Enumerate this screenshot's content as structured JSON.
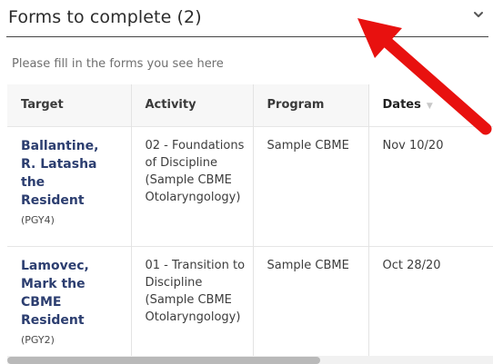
{
  "header": {
    "title": "Forms to complete (2)",
    "toggle_icon": "chevron-down-icon"
  },
  "subtitle": "Please fill in the forms you see here",
  "table": {
    "columns": [
      "Target",
      "Activity",
      "Program",
      "Dates"
    ],
    "sort_icon": "sort-down-icon",
    "rows": [
      {
        "target_name": "Ballantine, R. Latasha the Resident",
        "target_level": "(PGY4)",
        "activity": "02 - Foundations of Discipline (Sample CBME Otolaryngology)",
        "program": "Sample CBME",
        "date": "Nov 10/20"
      },
      {
        "target_name": "Lamovec, Mark the CBME Resident",
        "target_level": "(PGY2)",
        "activity": "01 - Transition to Discipline (Sample CBME Otolaryngology)",
        "program": "Sample CBME",
        "date": "Oct 28/20"
      }
    ]
  },
  "annotation": {
    "type": "red-arrow",
    "color": "#e8110f"
  },
  "colors": {
    "link": "#2c3e70",
    "header_bg": "#f7f7f7",
    "scroll_thumb": "#b9b9b9"
  }
}
